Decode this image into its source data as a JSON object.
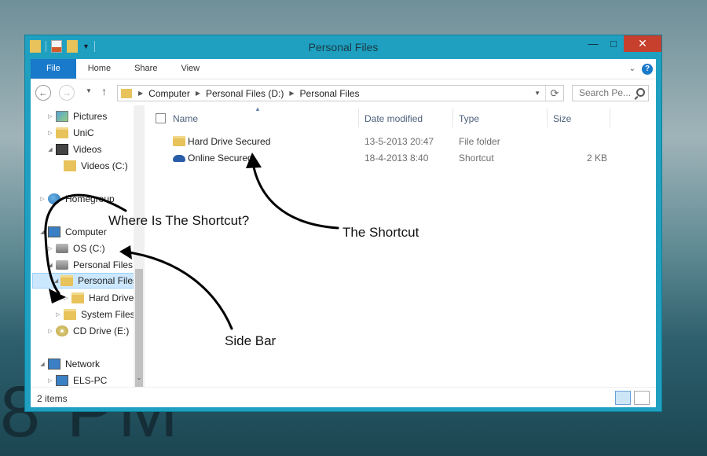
{
  "background": {
    "watermark_text": "8 PM"
  },
  "window": {
    "title": "Personal Files",
    "controls": {
      "minimize": "—",
      "maximize": "□",
      "close": "✕"
    }
  },
  "ribbon": {
    "tabs": [
      "File",
      "Home",
      "Share",
      "View"
    ],
    "help": "?",
    "collapse": "⌄"
  },
  "navigation": {
    "back": "←",
    "forward": "→",
    "recent": "▼",
    "up": "↑",
    "breadcrumb": [
      "Computer",
      "Personal Files (D:)",
      "Personal Files"
    ],
    "refresh": "⟳",
    "search_placeholder": "Search Pe..."
  },
  "sidebar": {
    "items": [
      {
        "label": "Pictures",
        "icon": "pictures-icon"
      },
      {
        "label": "UniC",
        "icon": "folder-icon"
      },
      {
        "label": "Videos",
        "icon": "videos-icon"
      },
      {
        "label": "Videos (C:)",
        "icon": "library-folder-icon"
      },
      {
        "label": "Homegroup",
        "icon": "homegroup-icon"
      },
      {
        "label": "Computer",
        "icon": "computer-icon"
      },
      {
        "label": "OS (C:)",
        "icon": "drive-icon"
      },
      {
        "label": "Personal Files",
        "icon": "drive-icon"
      },
      {
        "label": "Personal Files",
        "icon": "folder-icon",
        "selected": true
      },
      {
        "label": "Hard Drive",
        "icon": "folder-icon"
      },
      {
        "label": "System Files",
        "icon": "folder-icon"
      },
      {
        "label": "CD Drive (E:)",
        "icon": "cd-drive-icon"
      },
      {
        "label": "Network",
        "icon": "network-icon"
      },
      {
        "label": "ELS-PC",
        "icon": "pc-icon"
      }
    ]
  },
  "file_list": {
    "columns": [
      "Name",
      "Date modified",
      "Type",
      "Size"
    ],
    "rows": [
      {
        "name": "Hard Drive Secured",
        "date": "13-5-2013 20:47",
        "type": "File folder",
        "size": "",
        "icon": "folder-icon"
      },
      {
        "name": "Online Secured",
        "date": "18-4-2013 8:40",
        "type": "Shortcut",
        "size": "2 KB",
        "icon": "onedrive-cloud-icon"
      }
    ]
  },
  "status": {
    "item_count": "2 items"
  },
  "annotations": {
    "where_shortcut": "Where Is The Shortcut?",
    "the_shortcut": "The Shortcut",
    "side_bar": "Side Bar"
  },
  "colors": {
    "window_frame": "#1fa0c0",
    "file_tab": "#1979ca",
    "close_button": "#c7402e",
    "selected_row": "#cce8ff"
  }
}
